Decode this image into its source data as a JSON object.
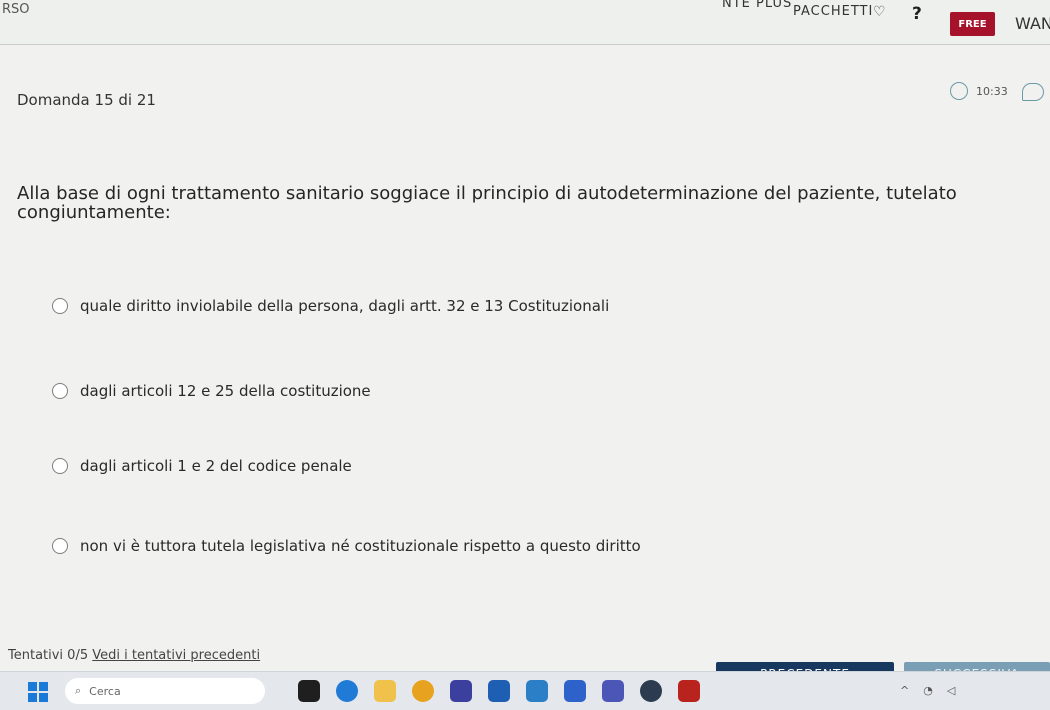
{
  "header": {
    "brand": "RSO",
    "nav_plus": "NTE PLUS",
    "nav_packages": "PACCHETTI",
    "help": "?",
    "free_badge": "FREE",
    "user": "WAN"
  },
  "quiz": {
    "progress": "Domanda 15 di 21",
    "timer": "10:33",
    "question": "Alla base di ogni trattamento sanitario soggiace il principio di autodeterminazione del paziente, tutelato congiuntamente:",
    "options": [
      "quale diritto inviolabile della persona, dagli artt. 32 e 13 Costituzionali",
      "dagli articoli 12 e 25 della costituzione",
      "dagli articoli 1 e 2 del codice penale",
      "non vi è tuttora tutela legislativa né costituzionale rispetto a questo diritto"
    ]
  },
  "footer": {
    "attempts": "Tentativi 0/5",
    "previous_attempts_link": "Vedi i tentativi precedenti",
    "prev_button": "PRECEDENTE",
    "next_button": "SUCCESSIVA"
  },
  "taskbar": {
    "search_placeholder": "Cerca"
  },
  "colors": {
    "free_badge": "#a5122a",
    "prev_button": "#17385f",
    "next_button": "#7a9fb4"
  }
}
